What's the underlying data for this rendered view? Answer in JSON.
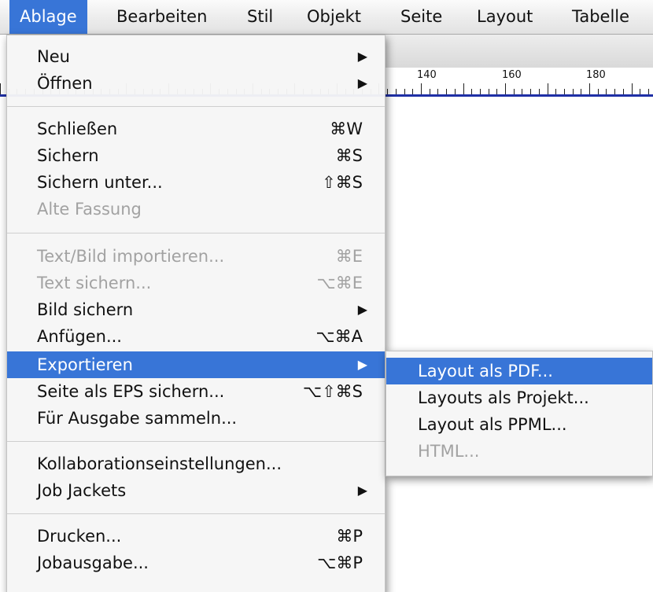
{
  "menubar": {
    "items": [
      {
        "label": "Ablage"
      },
      {
        "label": "Bearbeiten"
      },
      {
        "label": "Stil"
      },
      {
        "label": "Objekt"
      },
      {
        "label": "Seite"
      },
      {
        "label": "Layout"
      },
      {
        "label": "Tabelle"
      }
    ]
  },
  "ruler": {
    "labels": [
      "140",
      "160",
      "180"
    ]
  },
  "file_menu": {
    "items": [
      {
        "label": "Neu",
        "shortcut": "",
        "submenu": true
      },
      {
        "label": "Öffnen",
        "shortcut": "",
        "submenu": true
      },
      {
        "label": "Schließen",
        "shortcut": "⌘W"
      },
      {
        "label": "Sichern",
        "shortcut": "⌘S"
      },
      {
        "label": "Sichern unter...",
        "shortcut": "⇧⌘S"
      },
      {
        "label": "Alte Fassung",
        "shortcut": "",
        "disabled": true
      },
      {
        "label": "Text/Bild importieren...",
        "shortcut": "⌘E",
        "disabled": true
      },
      {
        "label": "Text sichern...",
        "shortcut": "⌥⌘E",
        "disabled": true
      },
      {
        "label": "Bild sichern",
        "shortcut": "",
        "submenu": true
      },
      {
        "label": "Anfügen...",
        "shortcut": "⌥⌘A"
      },
      {
        "label": "Exportieren",
        "shortcut": "",
        "submenu": true,
        "highlighted": true
      },
      {
        "label": "Seite als EPS sichern...",
        "shortcut": "⌥⇧⌘S"
      },
      {
        "label": "Für Ausgabe sammeln...",
        "shortcut": ""
      },
      {
        "label": "Kollaborationseinstellungen...",
        "shortcut": ""
      },
      {
        "label": "Job Jackets",
        "shortcut": "",
        "submenu": true
      },
      {
        "label": "Drucken...",
        "shortcut": "⌘P"
      },
      {
        "label": "Jobausgabe...",
        "shortcut": "⌥⌘P"
      }
    ]
  },
  "export_submenu": {
    "items": [
      {
        "label": "Layout als PDF...",
        "highlighted": true
      },
      {
        "label": "Layouts als Projekt..."
      },
      {
        "label": "Layout als PPML..."
      },
      {
        "label": "HTML...",
        "disabled": true
      }
    ]
  },
  "colors": {
    "highlight": "#3875d7",
    "disabled_text": "#a2a2a2",
    "ruler_rule": "#1f2fa5"
  },
  "icons": {
    "submenu_arrow": "triangle-right-icon"
  }
}
